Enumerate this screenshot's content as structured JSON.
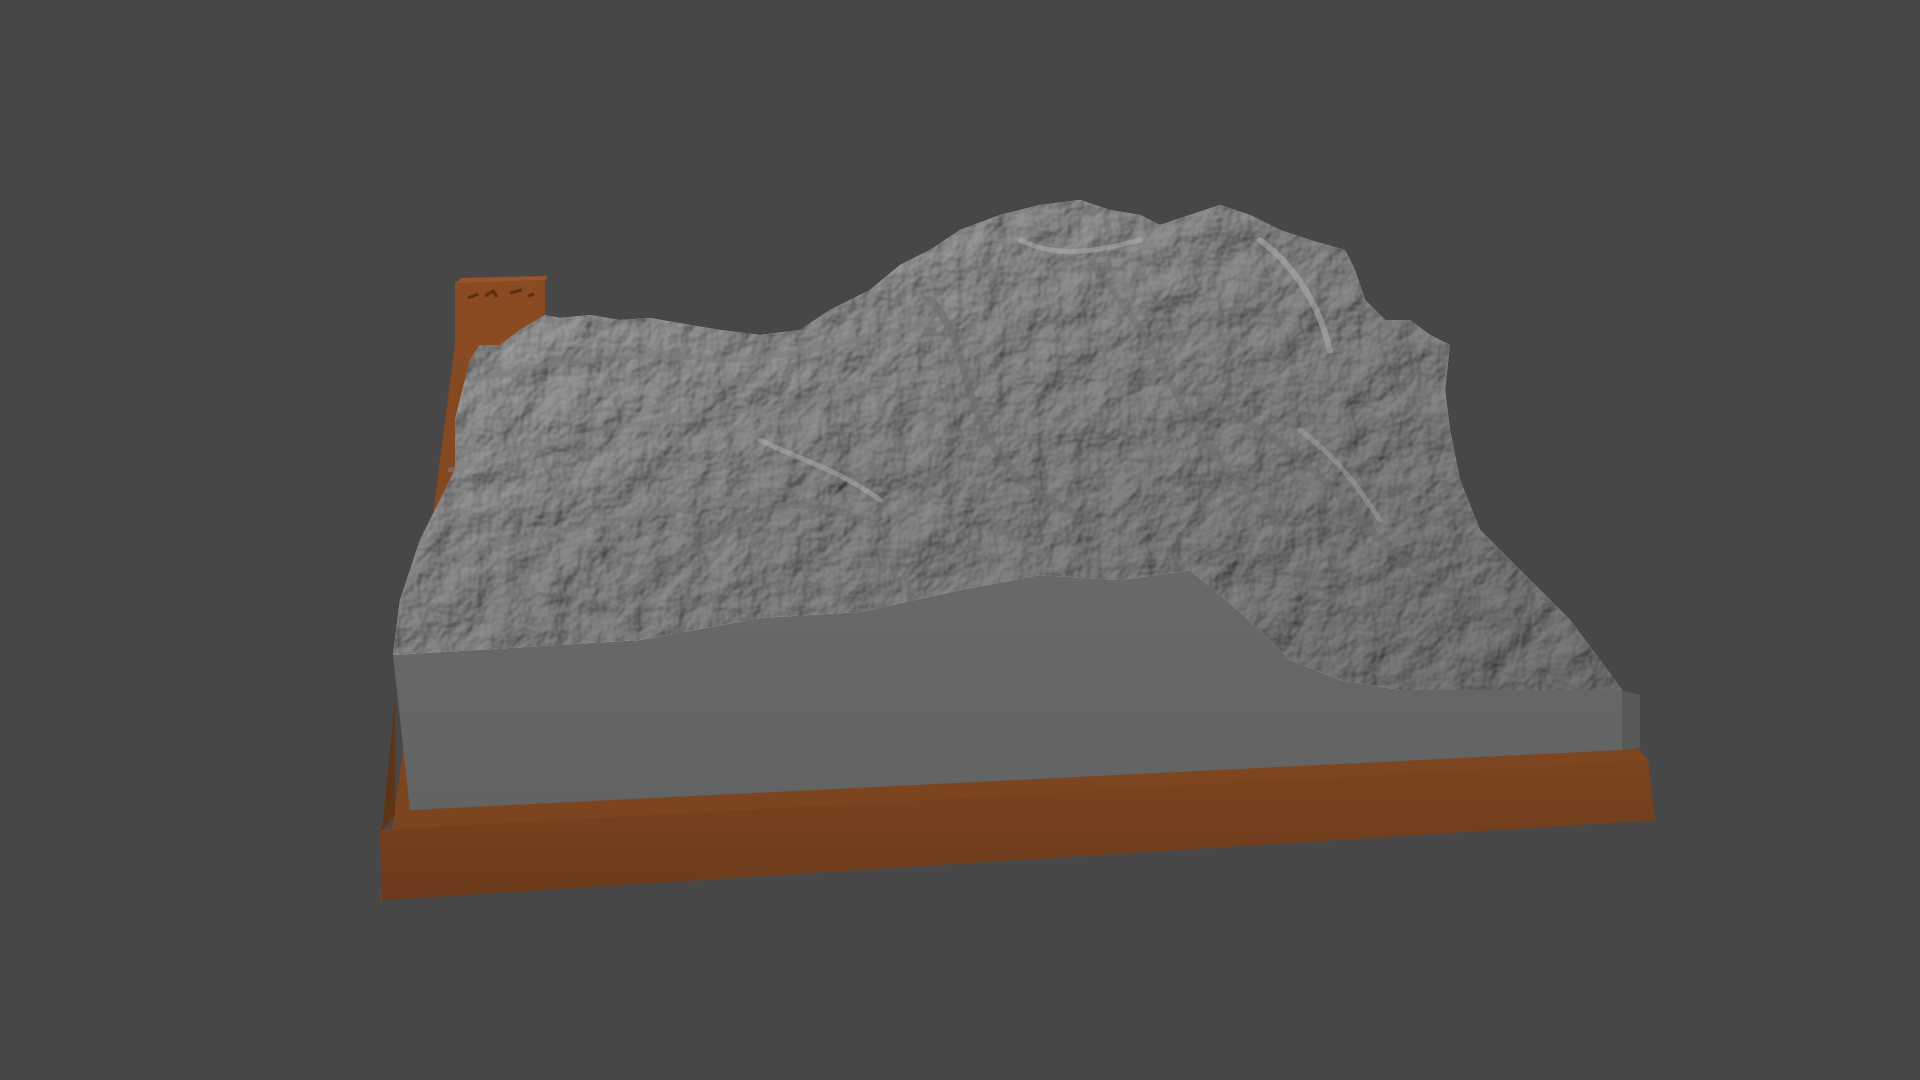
{
  "scene": {
    "background_color": "#474747",
    "subject": "terrain-relief-model",
    "colors": {
      "terrain": "#9a9a9a",
      "terrain_front_face": "#666767",
      "base": "#7a4520",
      "base_front": "#6e3d1c",
      "tag_block": "#8a4a22"
    },
    "tag_engraving_text": ""
  }
}
